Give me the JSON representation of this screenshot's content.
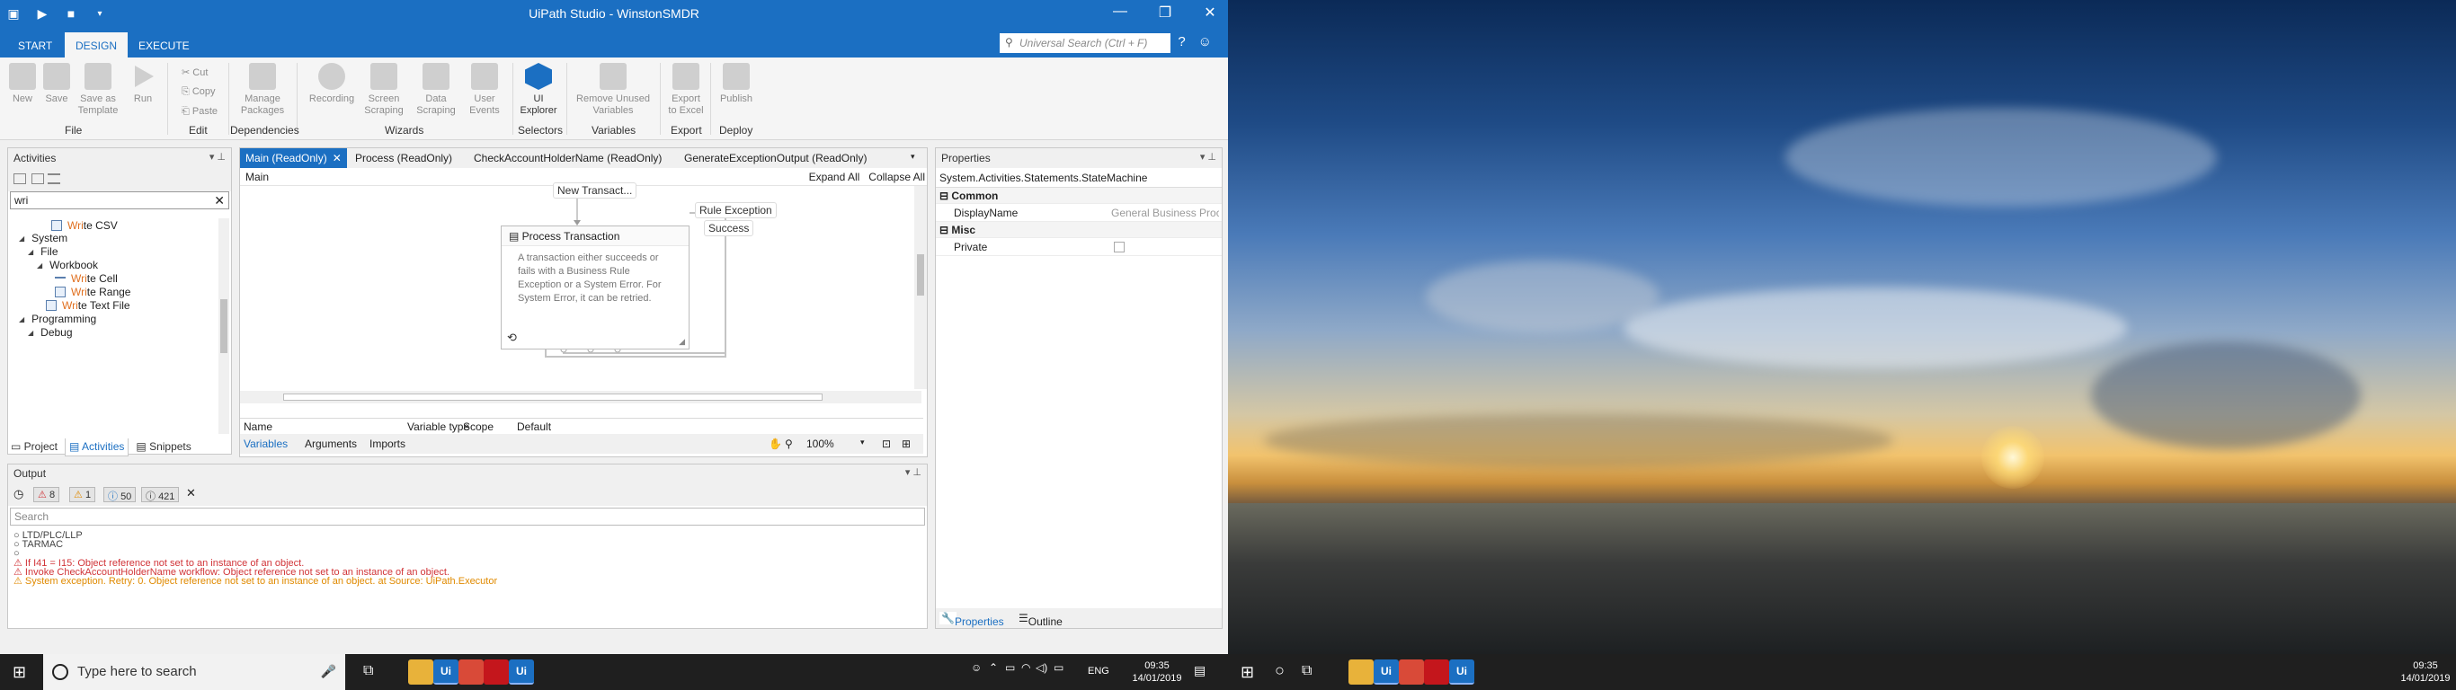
{
  "window": {
    "title": "UiPath Studio - WinstonSMDR",
    "controls": [
      "—",
      "❐",
      "✕"
    ]
  },
  "menu": {
    "tabs": [
      "START",
      "DESIGN",
      "EXECUTE"
    ],
    "search_placeholder": "Universal Search (Ctrl + F)"
  },
  "ribbon": {
    "new": "New",
    "save": "Save",
    "save_as_template_1": "Save as",
    "save_as_template_2": "Template",
    "run": "Run",
    "cut": "Cut",
    "copy": "Copy",
    "paste": "Paste",
    "manage_packages_1": "Manage",
    "manage_packages_2": "Packages",
    "recording": "Recording",
    "screen_scraping_1": "Screen",
    "screen_scraping_2": "Scraping",
    "data_scraping_1": "Data",
    "data_scraping_2": "Scraping",
    "user_events_1": "User",
    "user_events_2": "Events",
    "ui_explorer_1": "UI",
    "ui_explorer_2": "Explorer",
    "remove_unused_1": "Remove Unused",
    "remove_unused_2": "Variables",
    "export_excel_1": "Export",
    "export_excel_2": "to Excel",
    "publish": "Publish",
    "groups": {
      "file": "File",
      "edit": "Edit",
      "dependencies": "Dependencies",
      "wizards": "Wizards",
      "selectors": "Selectors",
      "variables": "Variables",
      "export": "Export",
      "deploy": "Deploy"
    }
  },
  "activities": {
    "title": "Activities",
    "search_value": "wri",
    "tree": {
      "write_csv_hl": "Wri",
      "write_csv_rest": "te CSV",
      "system": "System",
      "file": "File",
      "workbook": "Workbook",
      "write_cell_hl": "Wri",
      "write_cell_rest": "te Cell",
      "write_range_hl": "Wri",
      "write_range_rest": "te Range",
      "write_text_hl": "Wri",
      "write_text_rest": "te Text File",
      "programming": "Programming",
      "debug": "Debug"
    },
    "bottom_tabs": [
      "Project",
      "Activities",
      "Snippets"
    ]
  },
  "designer": {
    "tabs": [
      "Main (ReadOnly)",
      "Process (ReadOnly)",
      "CheckAccountHolderName (ReadOnly)",
      "GenerateExceptionOutput (ReadOnly)"
    ],
    "breadcrumb": "Main",
    "expand_all": "Expand All",
    "collapse_all": "Collapse All",
    "state": {
      "title": "Process Transaction",
      "description": "A transaction either succeeds or fails with a Business Rule Exception or a System Error. For System Error, it can be retried."
    },
    "labels": {
      "new_transact": "New Transact...",
      "rule_exception": "Rule Exception",
      "success": "Success"
    },
    "var_columns": [
      "Name",
      "Variable type",
      "Scope",
      "Default"
    ],
    "bottom_tabs": [
      "Variables",
      "Arguments",
      "Imports"
    ],
    "zoom": "100%"
  },
  "properties": {
    "title": "Properties",
    "type": "System.Activities.Statements.StateMachine",
    "categories": {
      "common": "Common",
      "misc": "Misc"
    },
    "display_name_key": "DisplayName",
    "display_name_value": "General Business Proc",
    "private_key": "Private",
    "bottom_tabs": [
      "Properties",
      "Outline"
    ]
  },
  "output": {
    "title": "Output",
    "filters": {
      "errors": "8",
      "warnings": "1",
      "info": "50",
      "trace": "421"
    },
    "search_placeholder": "Search",
    "lines": [
      {
        "text": "○ LTD/PLC/LLP",
        "color": "#444444"
      },
      {
        "text": "○ TARMAC",
        "color": "#444444"
      },
      {
        "text": "○",
        "color": "#444444"
      },
      {
        "text": "⚠ If I41 = I15: Object reference not set to an instance of an object.",
        "color": "#d13438"
      },
      {
        "text": "⚠ Invoke CheckAccountHolderName workflow: Object reference not set to an instance of an object.",
        "color": "#d13438"
      },
      {
        "text": "⚠ System exception. Retry: 0. Object reference not set to an instance of an object. at Source: UiPath.Executor",
        "color": "#e08a00"
      }
    ]
  },
  "taskbar1": {
    "search_placeholder": "Type here to search",
    "apps": [
      {
        "icon": "file-explorer-icon",
        "color": "#e8b23a",
        "label": ""
      },
      {
        "icon": "uipath-icon",
        "color": "#1b6fc2",
        "label": "Ui"
      },
      {
        "icon": "chrome-icon",
        "color": "#d94a38",
        "label": ""
      },
      {
        "icon": "acrobat-icon",
        "color": "#c4161c",
        "label": ""
      },
      {
        "icon": "uipath-icon",
        "color": "#1b6fc2",
        "label": "Ui"
      }
    ],
    "lang": "ENG",
    "time": "09:35",
    "date": "14/01/2019"
  },
  "taskbar2": {
    "apps": [
      {
        "icon": "file-explorer-icon",
        "color": "#e8b23a",
        "label": ""
      },
      {
        "icon": "uipath-icon",
        "color": "#1b6fc2",
        "label": "Ui"
      },
      {
        "icon": "chrome-icon",
        "color": "#d94a38",
        "label": ""
      },
      {
        "icon": "acrobat-icon",
        "color": "#c4161c",
        "label": ""
      },
      {
        "icon": "uipath-icon",
        "color": "#1b6fc2",
        "label": "Ui"
      }
    ],
    "time": "09:35",
    "date": "14/01/2019"
  },
  "colors": {
    "accent": "#1b6fc2",
    "error": "#d13438",
    "warning": "#e08a00"
  }
}
